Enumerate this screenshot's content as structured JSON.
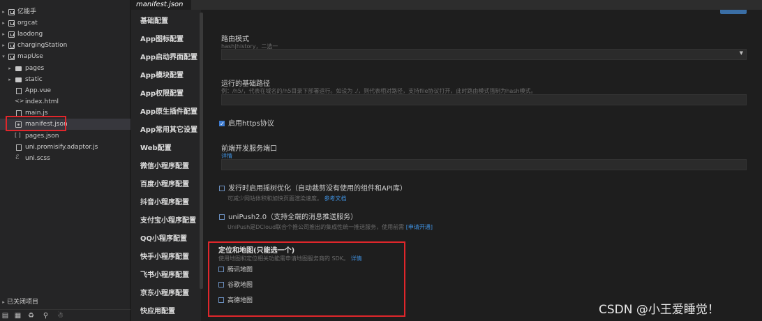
{
  "explorer": {
    "projects": [
      {
        "name": "亿能手"
      },
      {
        "name": "orgcat"
      },
      {
        "name": "laodong"
      },
      {
        "name": "chargingStation"
      },
      {
        "name": "mapUse"
      }
    ],
    "files": [
      {
        "name": "pages",
        "kind": "folder"
      },
      {
        "name": "static",
        "kind": "folder"
      },
      {
        "name": "App.vue",
        "kind": "doc"
      },
      {
        "name": "index.html",
        "kind": "code"
      },
      {
        "name": "main.js",
        "kind": "doc"
      },
      {
        "name": "manifest.json",
        "kind": "cog"
      },
      {
        "name": "pages.json",
        "kind": "brk"
      },
      {
        "name": "uni.promisify.adaptor.js",
        "kind": "doc"
      },
      {
        "name": "uni.scss",
        "kind": "sass"
      }
    ],
    "closed_projects_label": "已关闭项目"
  },
  "tab": {
    "label": "manifest.json"
  },
  "nav": {
    "items": [
      "基础配置",
      "App图标配置",
      "App启动界面配置",
      "App模块配置",
      "App权限配置",
      "App原生插件配置",
      "App常用其它设置",
      "Web配置",
      "微信小程序配置",
      "百度小程序配置",
      "抖音小程序配置",
      "支付宝小程序配置",
      "QQ小程序配置",
      "快手小程序配置",
      "飞书小程序配置",
      "京东小程序配置",
      "快应用配置"
    ]
  },
  "content": {
    "router": {
      "label": "路由模式",
      "hint": "hash|history，二选一",
      "value": ""
    },
    "base_path": {
      "label": "运行的基础路径",
      "hint": "例：/h5/，代表在域名的/h5目录下部署运行。如设为 ./，则代表相对路径，支持file协议打开，此时路由模式强制为hash模式。",
      "value": ""
    },
    "https": {
      "label": "启用https协议",
      "checked": true
    },
    "dev_port": {
      "label": "前端开发服务端口",
      "link": "详情",
      "value": ""
    },
    "tree_shaking": {
      "label": "发行时启用摇树优化（自动裁剪没有使用的组件和API库）",
      "hint": "可减少网站体积和加快页面渲染速度。",
      "link": "参考文档",
      "checked": false
    },
    "unipush": {
      "label": "uniPush2.0（支持全端的消息推送服务）",
      "hint": "UniPush是DCloud联合个推公司推出的集成性统一推送服务，使用前需",
      "link": "[申请开通]",
      "checked": false
    },
    "maps": {
      "title": "定位和地图(只能选一个)",
      "hint": "使用地图和定位相关功能需申请地图服务商的 SDK。",
      "link": "详情",
      "options": [
        {
          "label": "腾讯地图",
          "checked": false
        },
        {
          "label": "谷歌地图",
          "checked": false
        },
        {
          "label": "高德地图",
          "checked": false
        }
      ]
    }
  },
  "watermark": "CSDN @小王爱睡觉！",
  "colors": {
    "highlight_border": "#e0262b",
    "link": "#3f8fdc",
    "accent": "#3d7bd0"
  }
}
